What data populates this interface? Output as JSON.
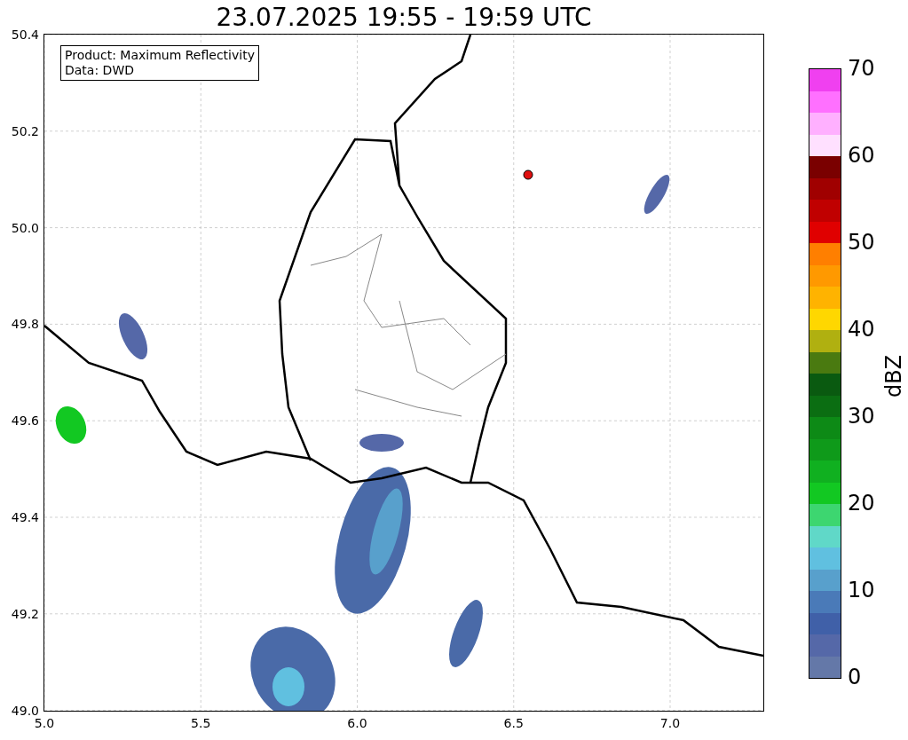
{
  "title": "23.07.2025 19:55 - 19:59 UTC",
  "map": {
    "legend": [
      "Product: Maximum Reflectivity",
      "Data: DWD"
    ],
    "xticks": [
      "5.0",
      "5.5",
      "6.0",
      "6.5",
      "7.0"
    ],
    "yticks": [
      "50.4",
      "50.2",
      "50.0",
      "49.8",
      "49.6",
      "49.4",
      "49.2",
      "49.0"
    ]
  },
  "colorbar": {
    "label": "dBZ",
    "ticks": [
      "70",
      "60",
      "50",
      "40",
      "30",
      "20",
      "10",
      "0"
    ],
    "levels": [
      {
        "color": "#f040f0"
      },
      {
        "color": "#ff70ff"
      },
      {
        "color": "#ffb0ff"
      },
      {
        "color": "#ffe0ff"
      },
      {
        "color": "#7a0000"
      },
      {
        "color": "#a00000"
      },
      {
        "color": "#c00000"
      },
      {
        "color": "#e00000"
      },
      {
        "color": "#ff7f00"
      },
      {
        "color": "#ff9900"
      },
      {
        "color": "#ffb300"
      },
      {
        "color": "#ffd700"
      },
      {
        "color": "#b0b010"
      },
      {
        "color": "#4a7a10"
      },
      {
        "color": "#0a5a10"
      },
      {
        "color": "#0b6e12"
      },
      {
        "color": "#0d8a16"
      },
      {
        "color": "#0f9a1a"
      },
      {
        "color": "#10b020"
      },
      {
        "color": "#12c822"
      },
      {
        "color": "#3dd670"
      },
      {
        "color": "#60d8c8"
      },
      {
        "color": "#60c0e0"
      },
      {
        "color": "#58a0cc"
      },
      {
        "color": "#4a7ab8"
      },
      {
        "color": "#4060a8"
      },
      {
        "color": "#5568a8"
      },
      {
        "color": "#6478a8"
      }
    ]
  }
}
